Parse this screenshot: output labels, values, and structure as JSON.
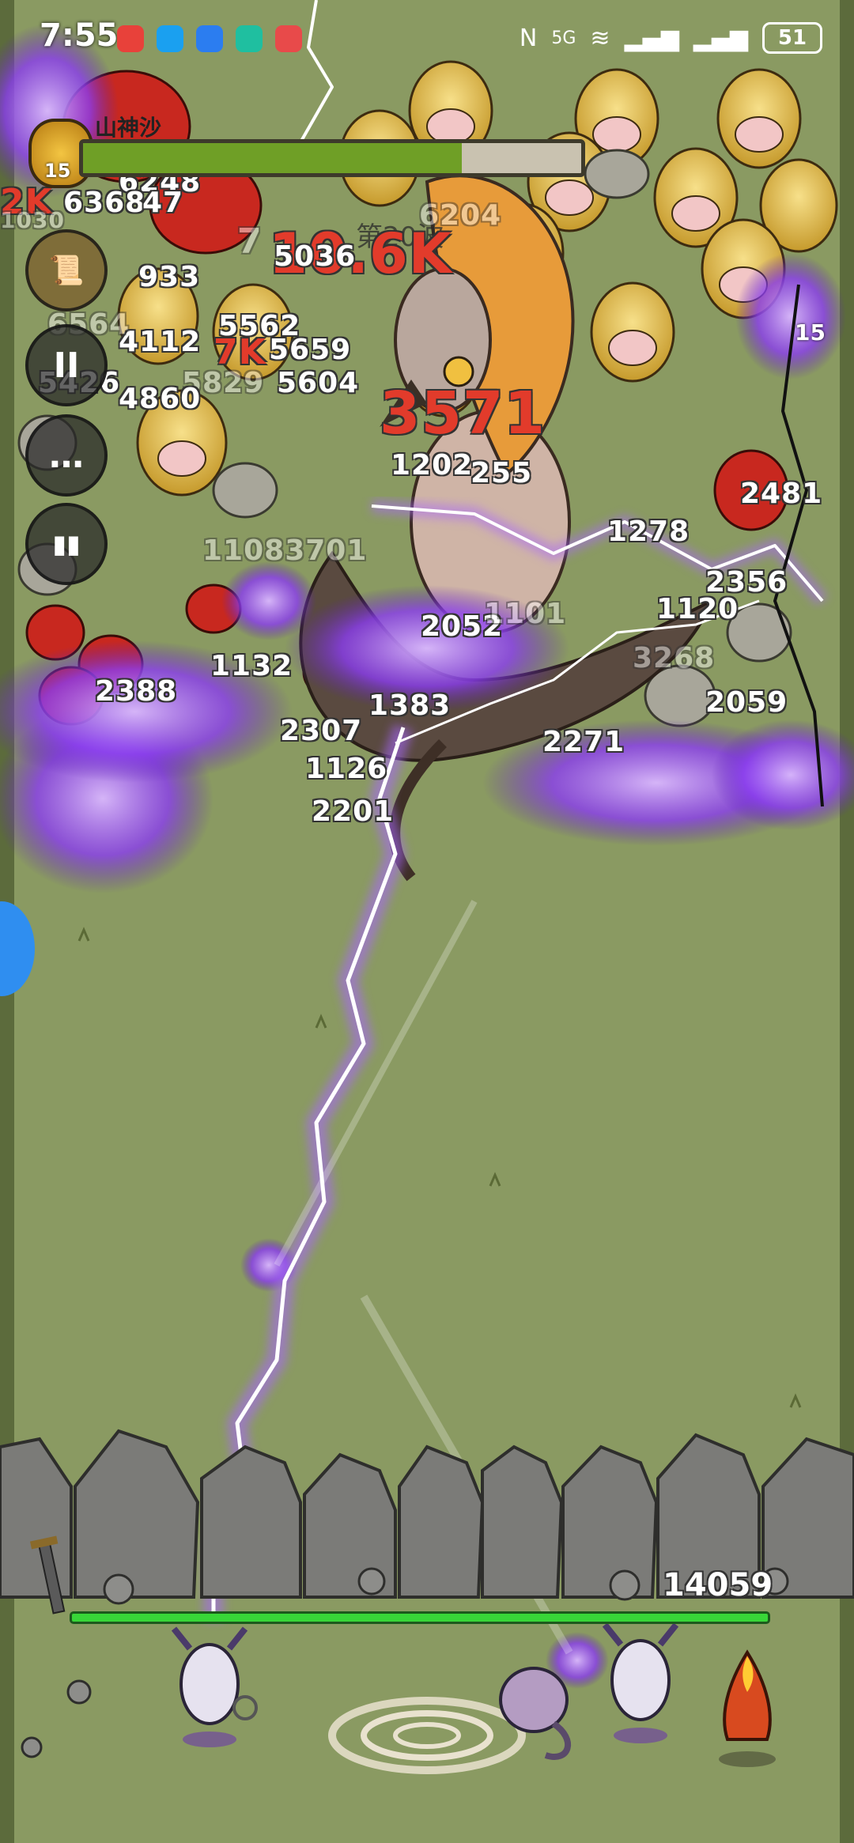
{
  "status_bar": {
    "time": "7:55",
    "network": "5G",
    "battery": "51"
  },
  "hud": {
    "boss_name": "山神沙",
    "level": "15",
    "boss_hp_fraction": 0.76,
    "wave_label": "第20波",
    "side_enemy_level": "15",
    "wall_hp": "14059",
    "wall_hp_fraction": 1.0
  },
  "side_buttons": [
    {
      "name": "scroll-icon"
    },
    {
      "name": "pause-icon",
      "glyph": "II"
    },
    {
      "name": "chat-icon",
      "glyph": "…"
    },
    {
      "name": "stats-icon",
      "glyph": "▮▮"
    }
  ],
  "damage_numbers": {
    "big": [
      "10.6K",
      "3571",
      "2K",
      "7K"
    ],
    "medium": [
      "5036",
      "6248",
      "6368",
      "47",
      "933",
      "5562",
      "4112",
      "5659",
      "5829",
      "5604",
      "5426",
      "4860",
      "1202",
      "255",
      "11083701",
      "2052",
      "1132",
      "2388",
      "2307",
      "1383",
      "1126",
      "2201",
      "2271",
      "1278",
      "2356",
      "1120",
      "3268",
      "2059",
      "2481",
      "6204",
      "1030"
    ],
    "faint": [
      "6564",
      "7",
      "1101"
    ]
  }
}
